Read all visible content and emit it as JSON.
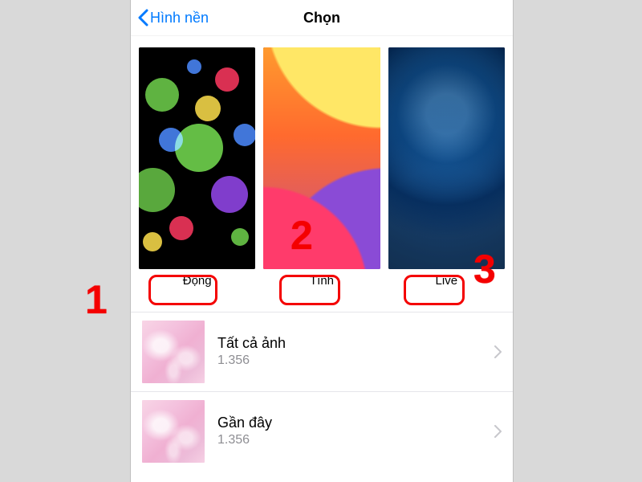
{
  "nav": {
    "back_label": "Hình nền",
    "title": "Chọn"
  },
  "wallpapers": [
    {
      "label": "Động"
    },
    {
      "label": "Tĩnh"
    },
    {
      "label": "Live"
    }
  ],
  "albums": [
    {
      "title": "Tất cả ảnh",
      "count": "1.356"
    },
    {
      "title": "Gần đây",
      "count": "1.356"
    }
  ],
  "annotations": {
    "n1": "1",
    "n2": "2",
    "n3": "3"
  }
}
